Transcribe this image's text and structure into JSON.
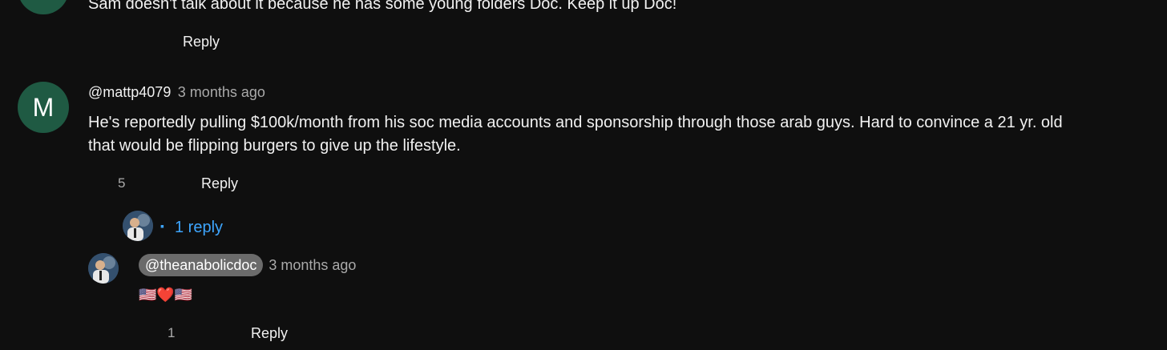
{
  "comment_prev": {
    "avatar_color": "#1f5a43",
    "text": "Sam doesn't talk about it because he has some young folders Doc. Keep it up Doc!",
    "reply_label": "Reply"
  },
  "comment_main": {
    "avatar_letter": "M",
    "avatar_color": "#1f5a43",
    "author": "@mattp4079",
    "time": "3 months ago",
    "text_line1": "He's reportedly pulling $100k/month from his soc media accounts and sponsorship through those arab guys. Hard to convince a 21 yr. old",
    "text_line2": "that would be flipping burgers to give up the lifestyle.",
    "like_count": "5",
    "reply_label": "Reply",
    "replies_bullet": "▪",
    "replies_link": "1 reply"
  },
  "reply": {
    "author": "@theanabolicdoc",
    "time": "3 months ago",
    "emoji_text": "🇺🇸❤️🇺🇸",
    "like_count": "1",
    "reply_label": "Reply"
  },
  "colors": {
    "background": "#0f0f0f",
    "link": "#3ea6ff",
    "badge": "#6b6b6b"
  }
}
